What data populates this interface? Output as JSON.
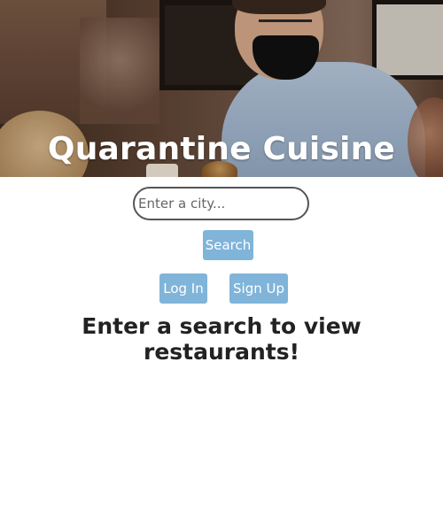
{
  "hero": {
    "title": "Quarantine Cuisine"
  },
  "search": {
    "placeholder": "Enter a city...",
    "value": "",
    "button_label": "Search"
  },
  "auth": {
    "login_label": "Log In",
    "signup_label": "Sign Up"
  },
  "results": {
    "empty_message": "Enter a search to view restaurants!"
  },
  "colors": {
    "button_bg": "#80b4d9",
    "button_text": "#ffffff",
    "heading_text": "#222222"
  }
}
